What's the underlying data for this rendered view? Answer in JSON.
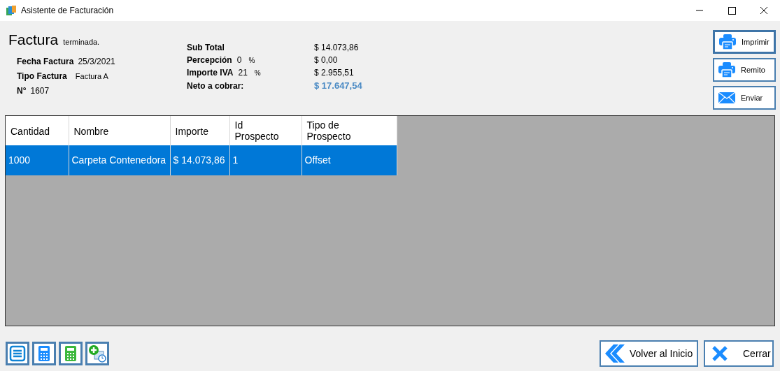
{
  "window": {
    "title": "Asistente de Facturación"
  },
  "invoice": {
    "title": "Factura",
    "status": "terminada.",
    "fields": [
      {
        "label": "Fecha Factura",
        "value": "25/3/2021"
      },
      {
        "label": "Tipo Factura",
        "value": "Factura A"
      },
      {
        "label": "N°",
        "value": "1607"
      }
    ]
  },
  "totals": [
    {
      "kind": "plain",
      "label": "Sub Total",
      "value": "$ 14.073,86"
    },
    {
      "kind": "percent",
      "label": "Percepción",
      "percent": "0",
      "unit": "%",
      "value": "$ 0,00"
    },
    {
      "kind": "percent",
      "label": "Importe IVA",
      "percent": "21",
      "unit": "%",
      "value": "$ 2.955,51"
    },
    {
      "kind": "total",
      "label": "Neto a cobrar:",
      "value": "$ 17.647,54"
    }
  ],
  "actions": [
    {
      "kind": "printer",
      "label": "Imprimir",
      "focused": true
    },
    {
      "kind": "printer",
      "label": "Remito",
      "focused": false
    },
    {
      "kind": "mail",
      "label": "Enviar",
      "focused": false
    }
  ],
  "table": {
    "columns": [
      "Cantidad",
      "Nombre",
      "Importe",
      "Id\nProspecto",
      "Tipo de\nProspecto"
    ],
    "rows": [
      {
        "cells": [
          "1000",
          "Carpeta Contenedora",
          "$ 14.073,86",
          "1",
          "Offset"
        ],
        "selected": true
      }
    ]
  },
  "nav_buttons": [
    {
      "kind": "back",
      "label": "Volver al Inicio"
    },
    {
      "kind": "close",
      "label": "Cerrar"
    }
  ]
}
